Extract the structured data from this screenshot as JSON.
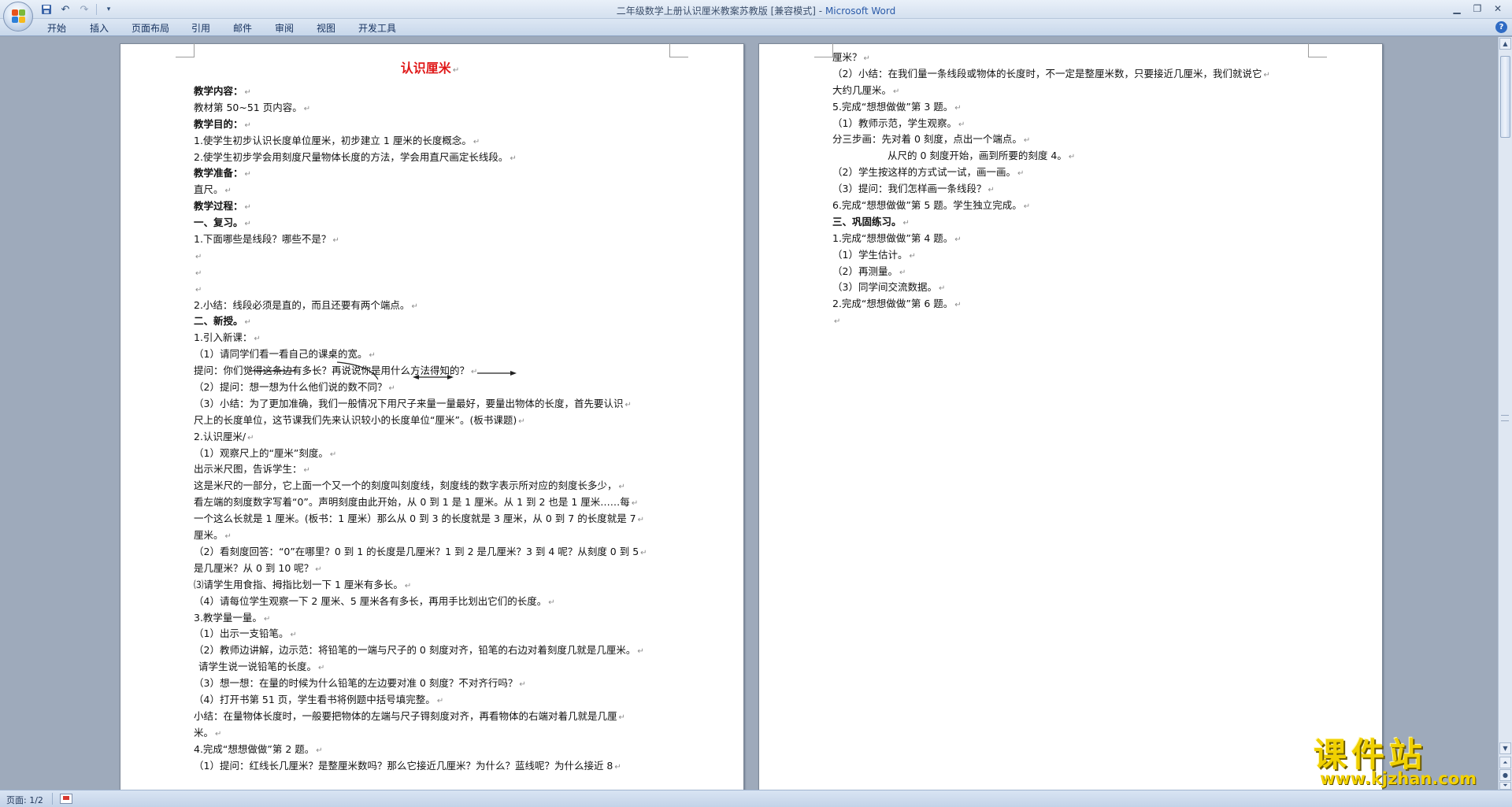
{
  "window": {
    "title_doc": "二年级数学上册认识厘米教案苏教版 [兼容模式]",
    "title_sep": " - ",
    "title_app": "Microsoft Word"
  },
  "qat": {
    "save_icon": "save-icon",
    "undo_icon": "undo-icon",
    "redo_icon": "redo-icon",
    "customize_icon": "customize-qat-icon"
  },
  "ribbon": {
    "tabs": [
      "开始",
      "插入",
      "页面布局",
      "引用",
      "邮件",
      "审阅",
      "视图",
      "开发工具"
    ]
  },
  "page1": {
    "title": "认识厘米",
    "lines": [
      {
        "t": "教学内容：",
        "b": true
      },
      {
        "t": "教材第 50~51 页内容。"
      },
      {
        "t": "教学目的：",
        "b": true
      },
      {
        "t": "1.使学生初步认识长度单位厘米，初步建立 1 厘米的长度概念。"
      },
      {
        "t": "2.使学生初步学会用刻度尺量物体长度的方法，学会用直尺画定长线段。"
      },
      {
        "t": "教学准备：",
        "b": true
      },
      {
        "t": "直尺。"
      },
      {
        "t": "教学过程：",
        "b": true
      },
      {
        "t": "一、复习。",
        "b": true
      },
      {
        "t": "1.下面哪些是线段？哪些不是？"
      },
      {
        "t": ""
      },
      {
        "t": ""
      },
      {
        "t": ""
      },
      {
        "t": "2.小结：线段必须是直的，而且还要有两个端点。"
      },
      {
        "t": "二、新授。",
        "b": true
      },
      {
        "t": "1.引入新课："
      },
      {
        "t": "（1）请同学们看一看自己的课桌的宽。"
      },
      {
        "t": "提问：你们觉得这条边有多长？再说说你是用什么方法得知的？"
      },
      {
        "t": "（2）提问：想一想为什么他们说的数不同？"
      },
      {
        "t": "（3）小结：为了更加准确，我们一般情况下用尺子来量一量最好，要量出物体的长度，首先要认识"
      },
      {
        "t": "尺上的长度单位，这节课我们先来认识较小的长度单位“厘米”。(板书课题)"
      },
      {
        "t": "2.认识厘米/"
      },
      {
        "t": "（1）观察尺上的“厘米”刻度。"
      },
      {
        "t": "出示米尺图，告诉学生："
      },
      {
        "t": "这是米尺的一部分，它上面一个又一个的刻度叫刻度线，刻度线的数字表示所对应的刻度长多少，"
      },
      {
        "t": "看左端的刻度数字写着“0”。声明刻度由此开始，从 0 到 1 是 1 厘米。从 1 到 2 也是 1 厘米……每"
      },
      {
        "t": "一个这么长就是 1 厘米。(板书：1 厘米）那么从 0 到 3 的长度就是 3 厘米，从 0 到 7 的长度就是 7"
      },
      {
        "t": "厘米。"
      },
      {
        "t": "（2）看刻度回答：“0”在哪里？0 到 1 的长度是几厘米？1 到 2 是几厘米？3 到 4 呢？从刻度 0 到 5"
      },
      {
        "t": "是几厘米？从 0 到 10 呢？"
      },
      {
        "t": "⑶请学生用食指、拇指比划一下 1 厘米有多长。"
      },
      {
        "t": "（4）请每位学生观察一下 2 厘米、5 厘米各有多长，再用手比划出它们的长度。"
      },
      {
        "t": "3.教学量一量。"
      },
      {
        "t": "（1）出示一支铅笔。"
      },
      {
        "t": "（2）教师边讲解，边示范：将铅笔的一端与尺子的 0 刻度对齐，铅笔的右边对着刻度几就是几厘米。"
      },
      {
        "t": "请学生说一说铅笔的长度。",
        "ind": true
      },
      {
        "t": "（3）想一想：在量的时候为什么铅笔的左边要对准 0 刻度？不对齐行吗？"
      },
      {
        "t": "（4）打开书第 51 页，学生看书将例题中括号填完整。"
      },
      {
        "t": "小结：在量物体长度时，一般要把物体的左端与尺子锝刻度对齐，再看物体的右端对着几就是几厘"
      },
      {
        "t": "米。"
      },
      {
        "t": "4.完成“想想做做”第 2 题。"
      },
      {
        "t": "（1）提问：红线长几厘米？是整厘米数吗？那么它接近几厘米？为什么？蓝线呢？为什么接近 8"
      }
    ]
  },
  "page2": {
    "lines": [
      {
        "t": "厘米？"
      },
      {
        "t": "（2）小结：在我们量一条线段或物体的长度时，不一定是整厘米数，只要接近几厘米，我们就说它"
      },
      {
        "t": "大约几厘米。"
      },
      {
        "t": "5.完成“想想做做”第 3 题。"
      },
      {
        "t": "（1）教师示范，学生观察。"
      },
      {
        "t": "分三步画：先对着 0 刻度，点出一个端点。"
      },
      {
        "t": "从尺的 0 刻度开始，画到所要的刻度 4。",
        "indent": true
      },
      {
        "t": "（2）学生按这样的方式试一试，画一画。"
      },
      {
        "t": "（3）提问：我们怎样画一条线段？"
      },
      {
        "t": "6.完成“想想做做”第 5 题。学生独立完成。"
      },
      {
        "t": "三、巩固练习。",
        "b": true
      },
      {
        "t": "1.完成“想想做做”第 4 题。"
      },
      {
        "t": "（1）学生估计。"
      },
      {
        "t": "（2）再测量。"
      },
      {
        "t": "（3）同学间交流数据。"
      },
      {
        "t": "2.完成“想想做做”第 6 题。"
      },
      {
        "t": ""
      }
    ]
  },
  "statusbar": {
    "page_count": "页面: 1/2"
  },
  "watermark": {
    "text": "课件站",
    "url": "www.kjzhan.com"
  },
  "colors": {
    "title_red": "#e01818",
    "watermark_yellow": "#f0d000"
  }
}
